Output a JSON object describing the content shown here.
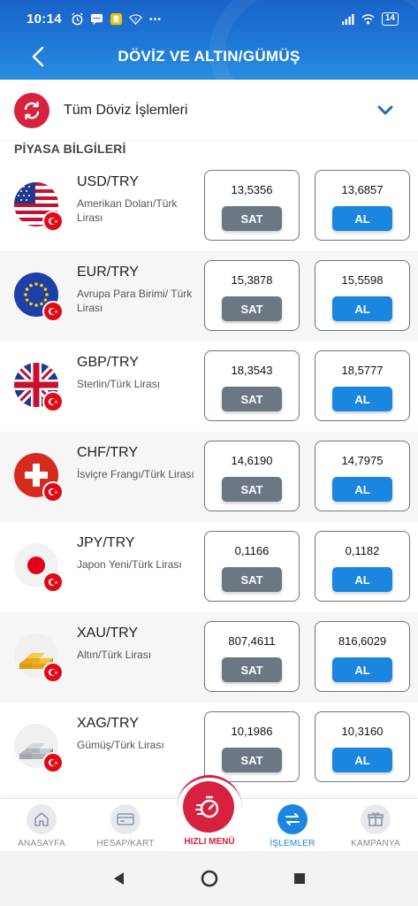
{
  "status_bar": {
    "time": "10:14",
    "battery": "14"
  },
  "header": {
    "title": "DÖVİZ VE ALTIN/GÜMÜŞ"
  },
  "filter": {
    "label": "Tüm Döviz İşlemleri"
  },
  "section_title": "PİYASA BİLGİLERİ",
  "rates": [
    {
      "pair": "USD/TRY",
      "description": "Amerikan Doları/Türk Lirası",
      "sell_price": "13,5356",
      "buy_price": "13,6857",
      "sell_label": "SAT",
      "buy_label": "AL",
      "flag": "us-flag-icon"
    },
    {
      "pair": "EUR/TRY",
      "description": "Avrupa Para Birimi/ Türk Lirası",
      "sell_price": "15,3878",
      "buy_price": "15,5598",
      "sell_label": "SAT",
      "buy_label": "AL",
      "flag": "eu-flag-icon"
    },
    {
      "pair": "GBP/TRY",
      "description": "Sterlin/Türk Lirası",
      "sell_price": "18,3543",
      "buy_price": "18,5777",
      "sell_label": "SAT",
      "buy_label": "AL",
      "flag": "uk-flag-icon"
    },
    {
      "pair": "CHF/TRY",
      "description": "İsviçre Frangı/Türk Lirası",
      "sell_price": "14,6190",
      "buy_price": "14,7975",
      "sell_label": "SAT",
      "buy_label": "AL",
      "flag": "swiss-flag-icon"
    },
    {
      "pair": "JPY/TRY",
      "description": "Japon Yeni/Türk Lirası",
      "sell_price": "0,1166",
      "buy_price": "0,1182",
      "sell_label": "SAT",
      "buy_label": "AL",
      "flag": "japan-flag-icon"
    },
    {
      "pair": "XAU/TRY",
      "description": "Altın/Türk Lirası",
      "sell_price": "807,4611",
      "buy_price": "816,6029",
      "sell_label": "SAT",
      "buy_label": "AL",
      "flag": "gold-bars-icon"
    },
    {
      "pair": "XAG/TRY",
      "description": "Gümüş/Türk Lirası",
      "sell_price": "10,1986",
      "buy_price": "10,3160",
      "sell_label": "SAT",
      "buy_label": "AL",
      "flag": "silver-bars-icon"
    }
  ],
  "bottom_nav": {
    "home": "ANASAYFA",
    "accounts": "HESAP/KART",
    "quick": "HIZLI MENÜ",
    "transactions": "İŞLEMLER",
    "campaign": "KAMPANYA"
  },
  "colors": {
    "header_blue": "#1f78d6",
    "accent_red": "#d6223e",
    "buy_blue": "#1a86df",
    "sell_gray": "#6b7884"
  }
}
